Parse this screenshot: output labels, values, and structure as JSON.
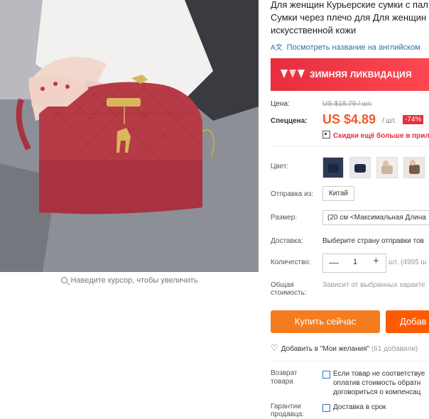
{
  "product": {
    "title_lines": [
      "Для женщин Курьерские сумки с пал",
      "Сумки через плечо для Для женщин",
      "искусственной кожи"
    ],
    "translate_link": "Посмотреть название на английском",
    "translate_icon": "translate-icon"
  },
  "banner": {
    "title": "ЗИМНЯЯ ЛИКВИДАЦИЯ"
  },
  "pricing": {
    "price_label": "Цена:",
    "old_price": "US $18.79 / шт.",
    "special_label": "Спеццена:",
    "new_price": "US $4.89",
    "unit": "/ шт.",
    "discount": "-74%",
    "coupon": "Скидки ещё больше в прил"
  },
  "options": {
    "color_label": "Цвет:",
    "ship_from_label": "Отправка из:",
    "ship_from_value": "Китай",
    "size_label": "Размер:",
    "size_value": "(20 см <Максимальная Длина",
    "delivery_label": "Доставка:",
    "delivery_value": "Выберите страну отправки тов",
    "quantity_label": "Количество:",
    "quantity_value": "1",
    "stock": "шт. (4995 ш",
    "total_label_1": "Общая",
    "total_label_2": "стоимость:",
    "total_value": "Зависит от выбранных характе"
  },
  "actions": {
    "buy_now": "Купить сейчас",
    "add_to_cart": "Добав",
    "wishlist": "Добавить в \"Мои желания\"",
    "wishlist_count": "(61 добавили)"
  },
  "guarantees": {
    "return_label_1": "Возврат",
    "return_label_2": "товара",
    "return_text": [
      "Если товар не соответствуе",
      "оплатив стоимость обратн",
      "договориться о компенсац"
    ],
    "guarantee_label_1": "Гарантии",
    "guarantee_label_2": "продавца:",
    "guarantee_text": "Доставка в срок"
  },
  "gallery": {
    "zoom_hint": "Наведите курсор, чтобы увеличить"
  },
  "colors": {
    "accent_orange": "#f57c1f",
    "price_red": "#f05a28",
    "banner_red": "#e62e3e",
    "link_blue": "#2c6fb4",
    "bag_red": "#b73a47"
  }
}
